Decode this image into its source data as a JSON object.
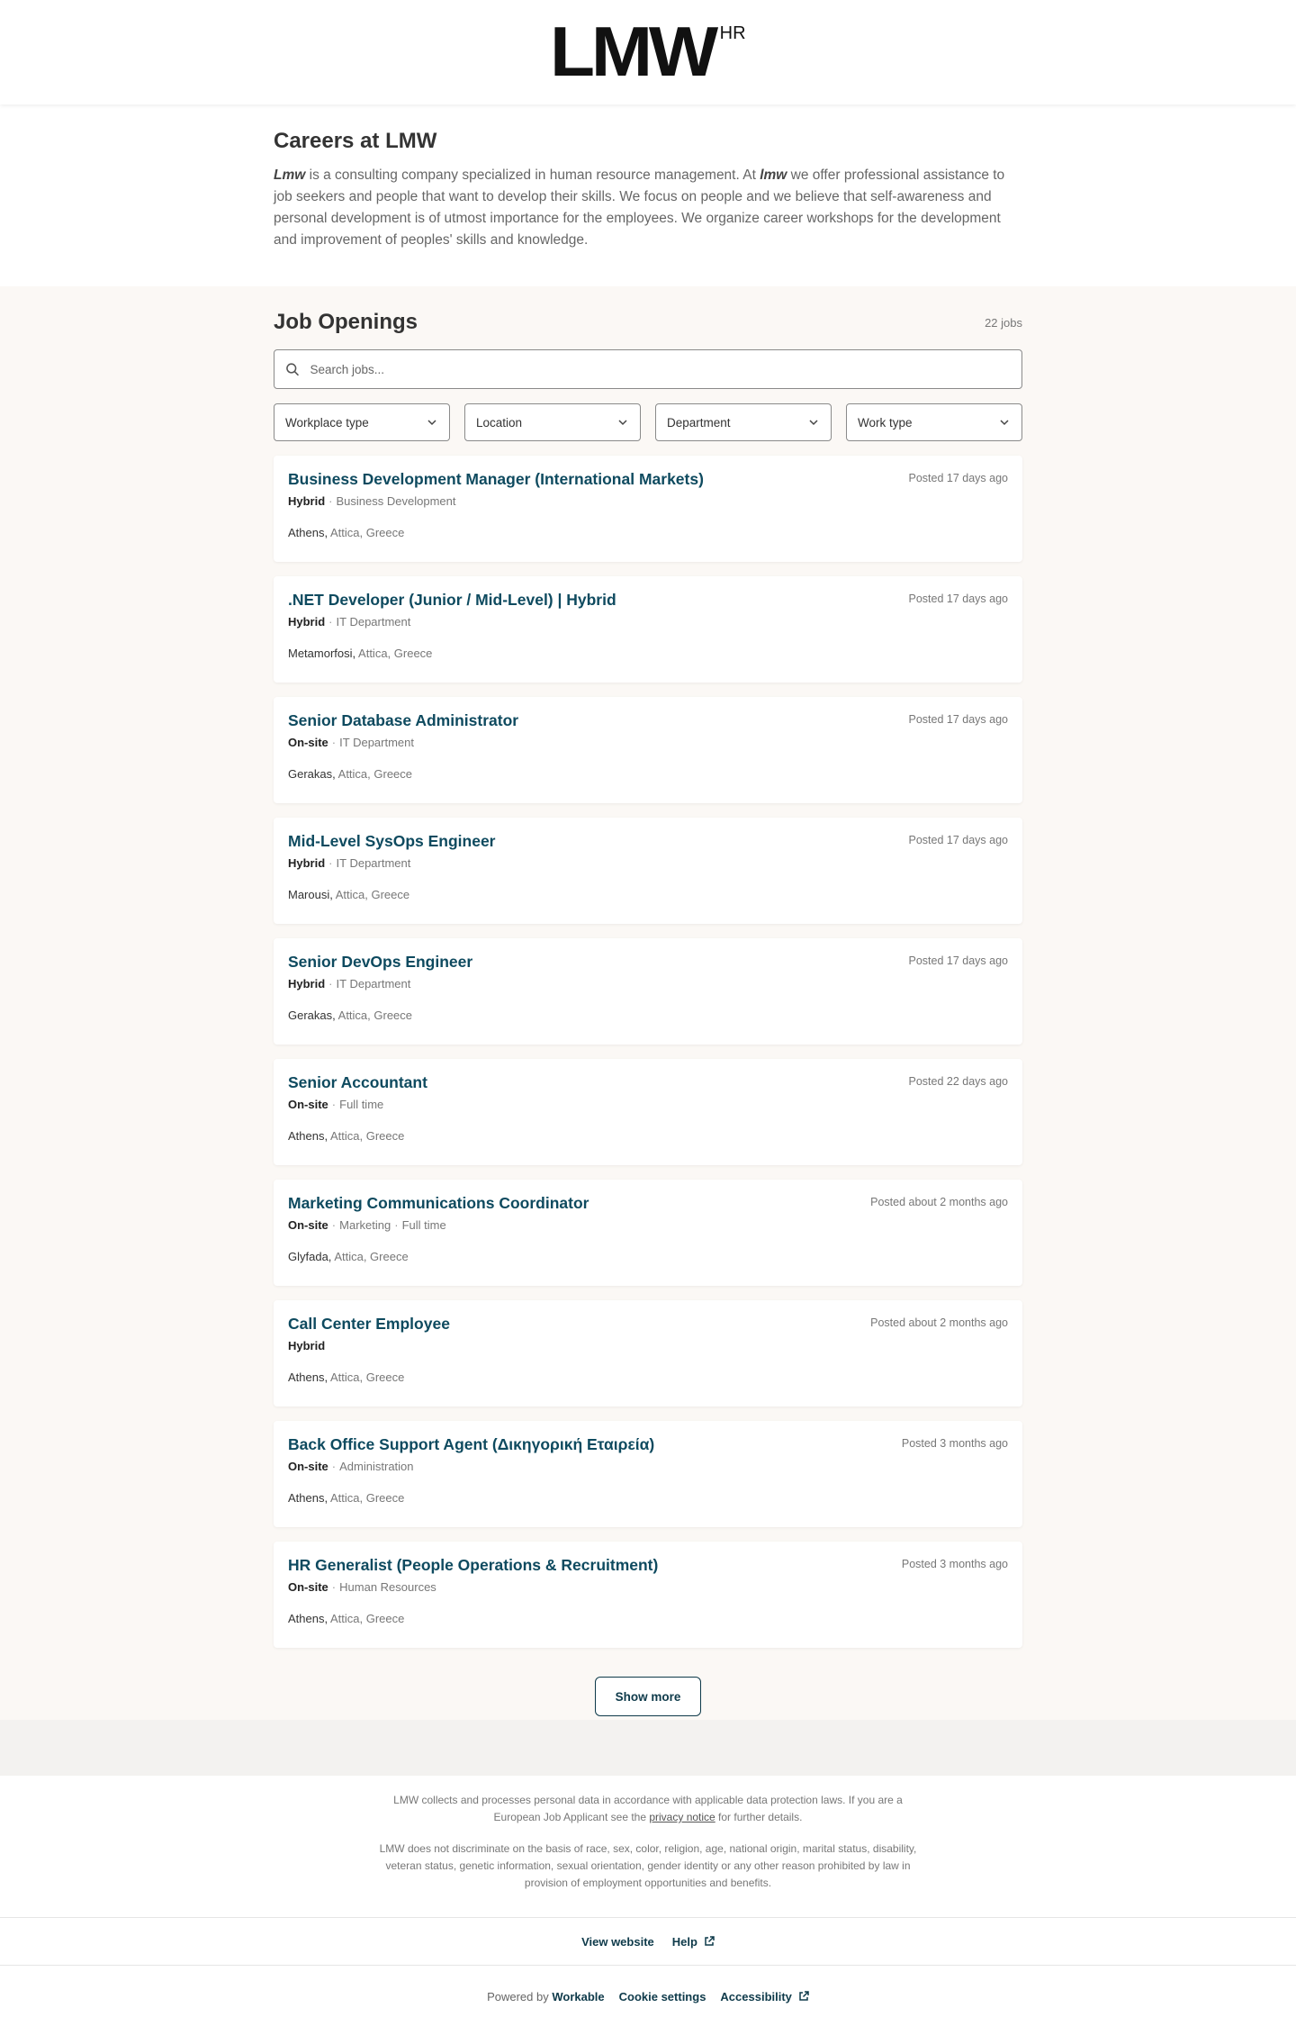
{
  "header": {
    "logo_main": "LMW",
    "logo_sup": "HR"
  },
  "intro": {
    "title": "Careers at LMW",
    "company_name": "Lmw",
    "text_1": " is a consulting company specialized in human resource management. At ",
    "company_name_2": "lmw",
    "text_2": " we offer professional assistance to job seekers and people that want to develop their skills. We focus on people and we believe that self-awareness and personal development is of utmost importance for the employees. We organize career workshops for the development and improvement of peoples' skills and knowledge."
  },
  "openings": {
    "title": "Job Openings",
    "count": "22 jobs",
    "search_placeholder": "Search jobs...",
    "filters": [
      "Workplace type",
      "Location",
      "Department",
      "Work type"
    ],
    "jobs": [
      {
        "title": "Business Development Manager (International Markets)",
        "posted": "Posted 17 days ago",
        "workplace": "Hybrid",
        "tags": [
          "Business Development"
        ],
        "city": "Athens,",
        "region": " Attica, Greece"
      },
      {
        "title": ".NET Developer (Junior / Mid-Level) | Hybrid",
        "posted": "Posted 17 days ago",
        "workplace": "Hybrid",
        "tags": [
          "IT Department"
        ],
        "city": "Metamorfosi,",
        "region": " Attica, Greece"
      },
      {
        "title": "Senior Database Administrator",
        "posted": "Posted 17 days ago",
        "workplace": "On-site",
        "tags": [
          "IT Department"
        ],
        "city": "Gerakas,",
        "region": " Attica, Greece"
      },
      {
        "title": "Mid-Level SysOps Engineer",
        "posted": "Posted 17 days ago",
        "workplace": "Hybrid",
        "tags": [
          "IT Department"
        ],
        "city": "Marousi,",
        "region": " Attica, Greece"
      },
      {
        "title": "Senior DevOps Engineer",
        "posted": "Posted 17 days ago",
        "workplace": "Hybrid",
        "tags": [
          "IT Department"
        ],
        "city": "Gerakas,",
        "region": " Attica, Greece"
      },
      {
        "title": "Senior Accountant",
        "posted": "Posted 22 days ago",
        "workplace": "On-site",
        "tags": [
          "Full time"
        ],
        "city": "Athens,",
        "region": " Attica, Greece"
      },
      {
        "title": "Marketing Communications Coordinator",
        "posted": "Posted about 2 months ago",
        "workplace": "On-site",
        "tags": [
          "Marketing",
          "Full time"
        ],
        "city": "Glyfada,",
        "region": " Attica, Greece"
      },
      {
        "title": "Call Center Employee",
        "posted": "Posted about 2 months ago",
        "workplace": "Hybrid",
        "tags": [],
        "city": "Athens,",
        "region": " Attica, Greece"
      },
      {
        "title": "Back Office Support Agent (Δικηγορική Εταιρεία)",
        "posted": "Posted 3 months ago",
        "workplace": "On-site",
        "tags": [
          "Administration"
        ],
        "city": "Athens,",
        "region": " Attica, Greece"
      },
      {
        "title": "HR Generalist (People Operations & Recruitment)",
        "posted": "Posted 3 months ago",
        "workplace": "On-site",
        "tags": [
          "Human Resources"
        ],
        "city": "Athens,",
        "region": " Attica, Greece"
      }
    ],
    "show_more": "Show more"
  },
  "legal": {
    "p1_a": "LMW collects and processes personal data in accordance with applicable data protection laws. If you are a European Job Applicant see the ",
    "p1_link": "privacy notice",
    "p1_b": " for further details.",
    "p2": "LMW does not discriminate on the basis of race, sex, color, religion, age, national origin, marital status, disability, veteran status, genetic information, sexual orientation, gender identity or any other reason prohibited by law in provision of employment opportunities and benefits."
  },
  "footer": {
    "view_website": "View website",
    "help": "Help",
    "powered_by": "Powered by",
    "powered_brand": "Workable",
    "cookie_settings": "Cookie settings",
    "accessibility": "Accessibility"
  },
  "colors": {
    "job_title": "#0e4a5f",
    "openings_bg": "#fbf8f5",
    "brand_dark": "#0e3a4a"
  }
}
